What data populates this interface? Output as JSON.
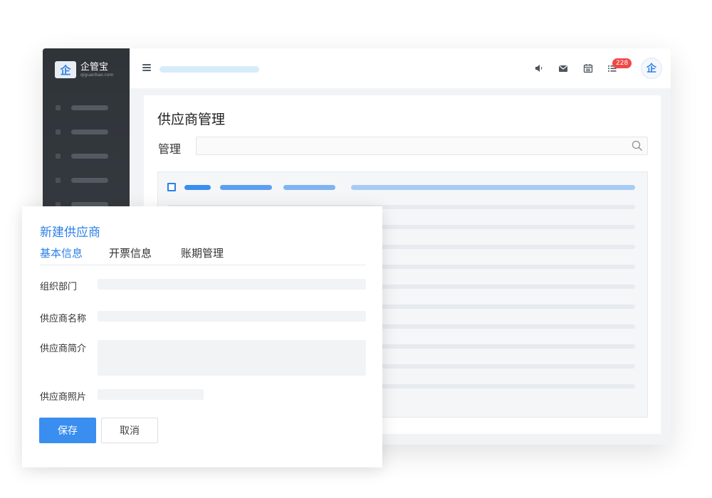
{
  "brand": {
    "logo_glyph": "企",
    "name": "企管宝",
    "domain": "qiguanbao.com",
    "accent_color": "#2e80e6"
  },
  "topbar": {
    "icons": [
      "menu-icon",
      "megaphone-icon",
      "mail-icon",
      "calendar-icon",
      "task-list-icon"
    ],
    "notification_count": "228",
    "avatar_glyph": "企"
  },
  "page": {
    "title": "供应商管理",
    "filter_label": "管理",
    "search_placeholder": ""
  },
  "modal": {
    "title": "新建供应商",
    "tabs": [
      {
        "label": "基本信息",
        "active": true
      },
      {
        "label": "开票信息",
        "active": false
      },
      {
        "label": "账期管理",
        "active": false
      }
    ],
    "fields": [
      {
        "label": "组织部门"
      },
      {
        "label": "供应商名称"
      },
      {
        "label": "供应商简介"
      },
      {
        "label": "供应商照片"
      }
    ],
    "save_label": "保存",
    "cancel_label": "取消"
  }
}
